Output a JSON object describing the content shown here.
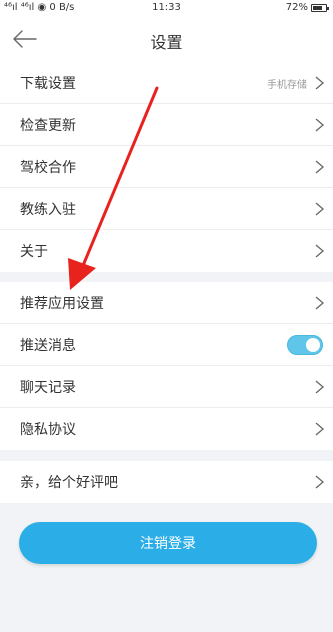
{
  "status_bar": {
    "left": "⁴⁶ıl ⁴⁶ıl ◉ 0 B/s",
    "time": "11:33",
    "battery": "72%",
    "battery_level": 0.72
  },
  "header": {
    "title": "设置",
    "back_icon": "arrow-left-icon"
  },
  "settings": {
    "group1": [
      {
        "label": "下载设置",
        "value": "手机存储"
      },
      {
        "label": "检查更新"
      },
      {
        "label": "驾校合作"
      },
      {
        "label": "教练入驻"
      },
      {
        "label": "关于"
      }
    ],
    "group2": [
      {
        "label": "推荐应用设置"
      },
      {
        "label": "推送消息",
        "toggle": true
      },
      {
        "label": "聊天记录"
      },
      {
        "label": "隐私协议"
      }
    ],
    "group3": [
      {
        "label": "亲，给个好评吧"
      }
    ]
  },
  "logout_button": "注销登录",
  "colors": {
    "accent": "#2baee8",
    "toggle_on": "#5fc6ea",
    "annotation_arrow": "#e8221d"
  }
}
